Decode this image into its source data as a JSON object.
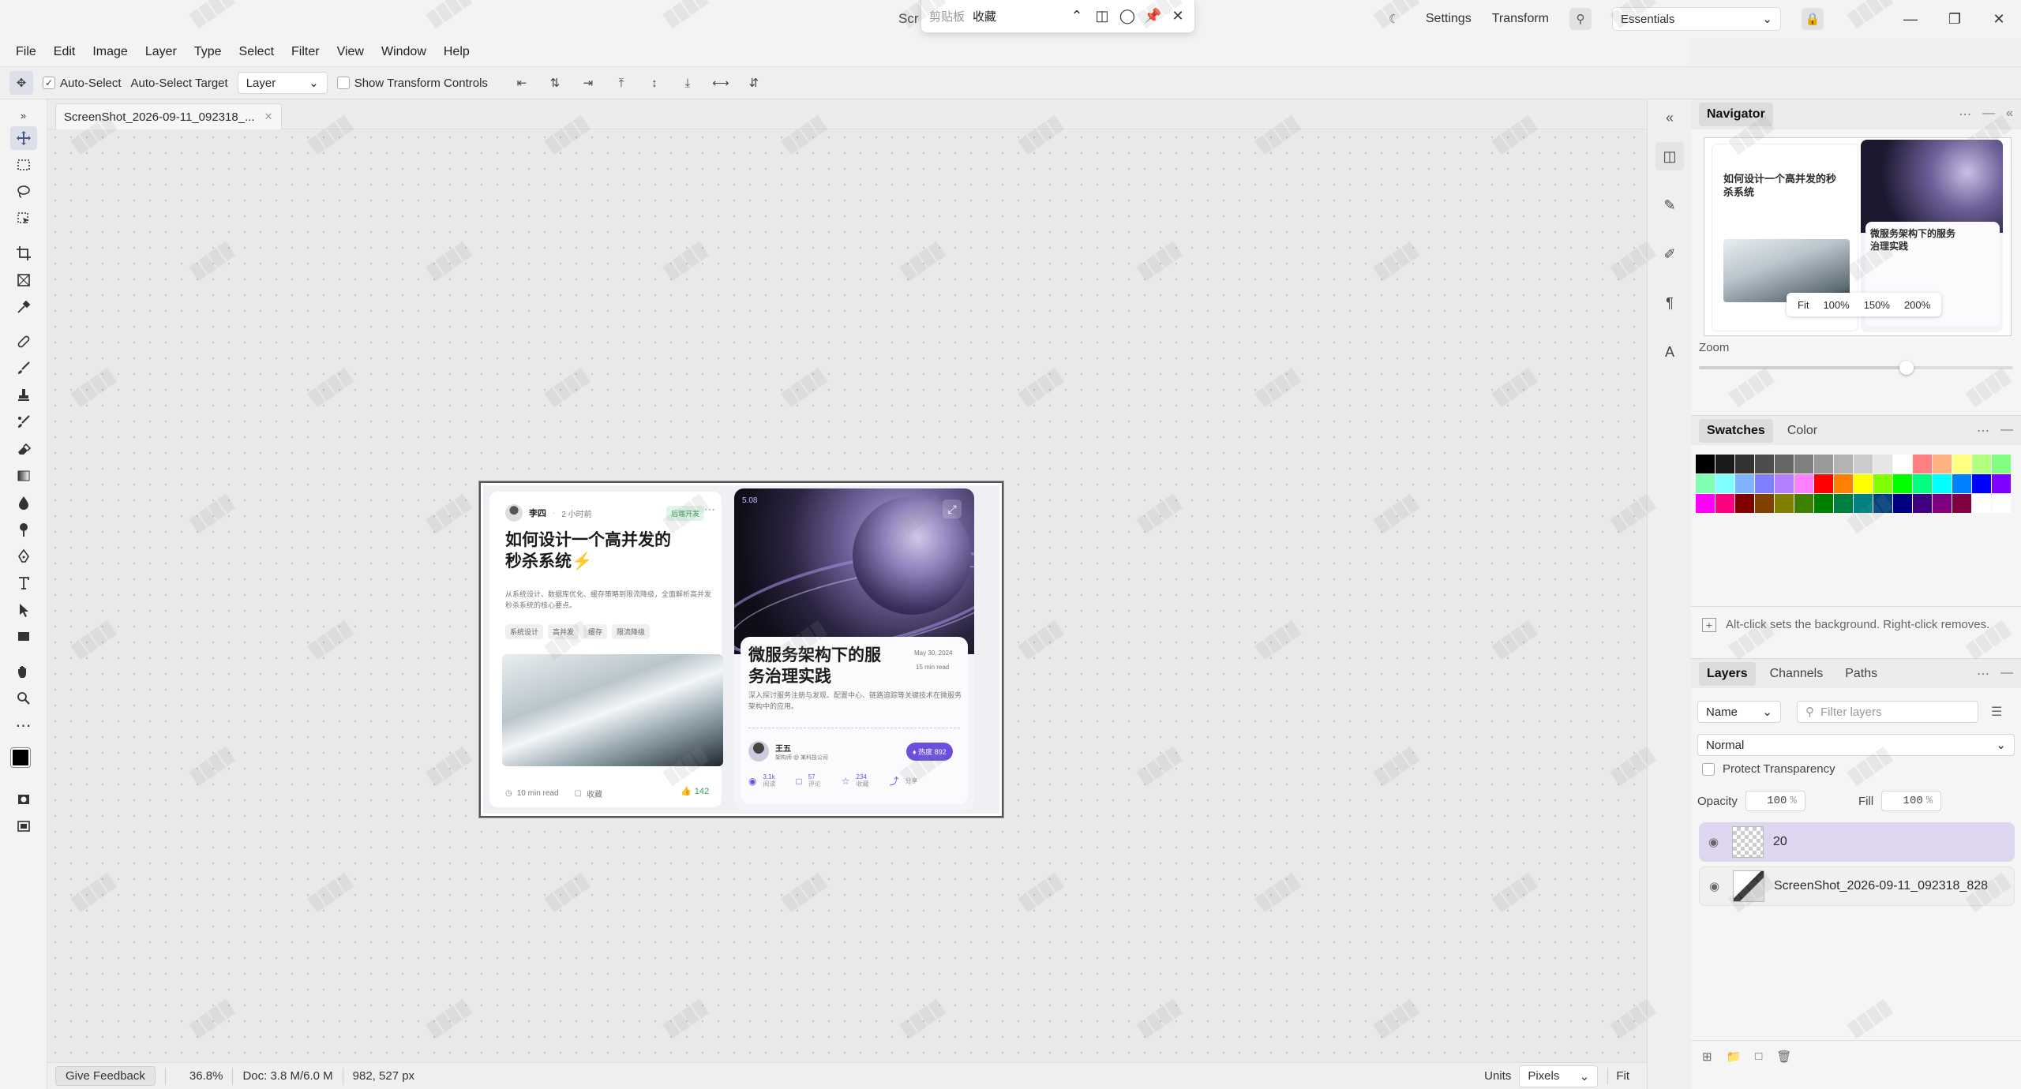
{
  "titlebar": {
    "doc_title": "Scr",
    "settings": "Settings",
    "transform": "Transform",
    "workspace": "Essentials"
  },
  "clipboard_popup": {
    "tab1": "剪贴板",
    "tab2": "收藏"
  },
  "menu": [
    "File",
    "Edit",
    "Image",
    "Layer",
    "Type",
    "Select",
    "Filter",
    "View",
    "Window",
    "Help"
  ],
  "options": {
    "auto_select": "Auto-Select",
    "auto_select_target": "Auto-Select Target",
    "target_value": "Layer",
    "show_transform": "Show Transform Controls"
  },
  "document": {
    "tab_name": "ScreenShot_2026-09-11_092318_..."
  },
  "status": {
    "feedback": "Give Feedback",
    "zoom": "36.8%",
    "doc_size": "Doc: 3.8 M/6.0 M",
    "dimensions": "982, 527 px",
    "units_label": "Units",
    "units_value": "Pixels",
    "fit": "Fit"
  },
  "card1": {
    "author": "李四",
    "time": "2 小时前",
    "badge": "后端开发",
    "title": "如何设计一个高并发的秒杀系统",
    "desc": "从系统设计、数据库优化、缓存策略到限流降级，全面解析高并发秒杀系统的核心要点。",
    "tags": [
      "系统设计",
      "高并发",
      "缓存",
      "限流降级"
    ],
    "read": "10 min read",
    "save": "收藏",
    "likes": "142"
  },
  "card2": {
    "date_badge": "5.08",
    "title": "微服务架构下的服务治理实践",
    "date": "May 30, 2024",
    "read": "15 min read",
    "desc": "深入探讨服务注册与发现、配置中心、链路追踪等关键技术在微服务架构中的应用。",
    "author": "王五",
    "role": "架构师 @ 某科技公司",
    "hot": "热度 892",
    "views": "3.1k",
    "views_label": "阅读",
    "comments": "57",
    "comments_label": "评论",
    "stars": "234",
    "stars_label": "收藏",
    "share_label": "分享"
  },
  "navigator": {
    "title": "Navigator",
    "zoom_label": "Zoom",
    "zoom_level": 0.66,
    "zoom_buttons": [
      "Fit",
      "100%",
      "150%",
      "200%"
    ]
  },
  "swatches": {
    "tab_swatches": "Swatches",
    "tab_color": "Color",
    "hint": "Alt-click sets the background. Right-click removes.",
    "colors": [
      "#000000",
      "#1a1a1a",
      "#333333",
      "#4d4d4d",
      "#666666",
      "#808080",
      "#999999",
      "#b3b3b3",
      "#cccccc",
      "#e6e6e6",
      "#ffffff",
      "#ff8080",
      "#ffb380",
      "#ffff80",
      "#b3ff80",
      "#80ff80",
      "#80ffb3",
      "#80ffff",
      "#80b3ff",
      "#8080ff",
      "#b380ff",
      "#ff80ff",
      "#ff0000",
      "#ff8000",
      "#ffff00",
      "#80ff00",
      "#00ff00",
      "#00ff80",
      "#00ffff",
      "#0080ff",
      "#0000ff",
      "#8000ff",
      "#ff00ff",
      "#ff0080",
      "#800000",
      "#804000",
      "#808000",
      "#408000",
      "#008000",
      "#008040",
      "#008080",
      "#004080",
      "#000080",
      "#400080",
      "#800080",
      "#800040",
      "#ffffff",
      "#ffffff"
    ]
  },
  "layers": {
    "tab_layers": "Layers",
    "tab_channels": "Channels",
    "tab_paths": "Paths",
    "sort": "Name",
    "filter_placeholder": "Filter layers",
    "blend": "Normal",
    "protect": "Protect Transparency",
    "opacity_label": "Opacity",
    "opacity": "100",
    "fill_label": "Fill",
    "fill": "100",
    "pct": "%",
    "items": [
      {
        "name": "20"
      },
      {
        "name": "ScreenShot_2026-09-11_092318_828"
      }
    ]
  },
  "colors": {
    "accent": "#6c4de0",
    "selected_layer": "#ddd6ee"
  }
}
